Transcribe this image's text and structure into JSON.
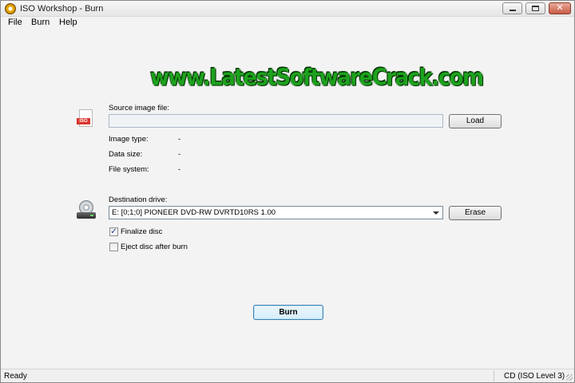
{
  "window": {
    "title": "ISO Workshop - Burn"
  },
  "menu": {
    "items": [
      "File",
      "Burn",
      "Help"
    ]
  },
  "watermark": "www.LatestSoftwareCrack.com",
  "source": {
    "label": "Source image file:",
    "value": "",
    "icon_badge": "ISO",
    "load_label": "Load",
    "info": [
      {
        "label": "Image type:",
        "value": "-"
      },
      {
        "label": "Data size:",
        "value": "-"
      },
      {
        "label": "File system:",
        "value": "-"
      }
    ]
  },
  "destination": {
    "label": "Destination drive:",
    "selected": "E:  [0;1;0] PIONEER DVD-RW DVRTD10RS 1.00",
    "erase_label": "Erase"
  },
  "options": {
    "finalize": {
      "label": "Finalize disc",
      "checked": true
    },
    "eject": {
      "label": "Eject disc after burn",
      "checked": false
    }
  },
  "actions": {
    "burn_label": "Burn"
  },
  "status": {
    "left": "Ready",
    "right": "CD (ISO Level 3)"
  },
  "colors": {
    "watermark": "#1ea21e",
    "iso_badge": "#d9342b",
    "burn_border": "#3c7fb1"
  }
}
